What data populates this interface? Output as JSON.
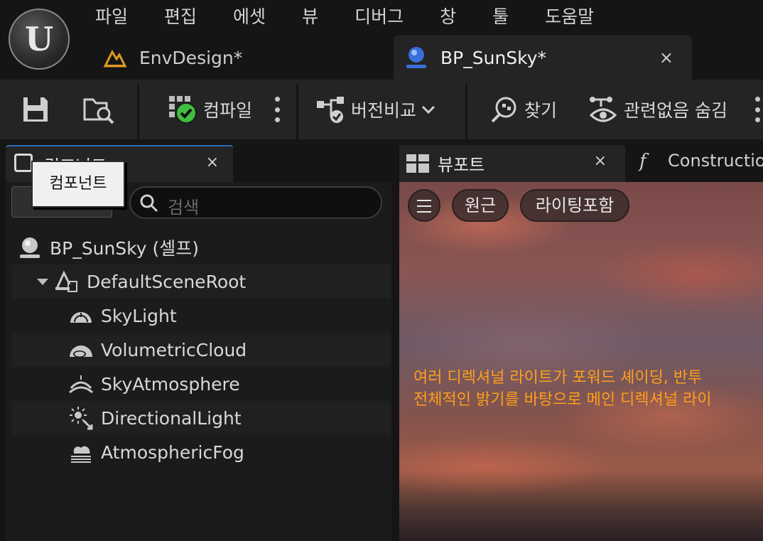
{
  "menu": [
    "파일",
    "편집",
    "에셋",
    "뷰",
    "디버그",
    "창",
    "툴",
    "도움말"
  ],
  "tabs": [
    {
      "label": "EnvDesign*"
    },
    {
      "label": "BP_SunSky*",
      "close": "×"
    }
  ],
  "toolbar": {
    "compile_label": "컴파일",
    "diff_label": "버전비교",
    "find_label": "찾기",
    "hide_label": "관련없음 숨김"
  },
  "components_panel": {
    "tab_label": "컴포넌트",
    "close": "×",
    "search_placeholder": "검색",
    "tooltip": "컴포넌트",
    "tree": [
      {
        "label": "BP_SunSky (셀프)",
        "icon": "sunsky-icon"
      },
      {
        "label": "DefaultSceneRoot",
        "icon": "scene-root-icon"
      },
      {
        "label": "SkyLight",
        "icon": "skylight-icon"
      },
      {
        "label": "VolumetricCloud",
        "icon": "cloud-icon"
      },
      {
        "label": "SkyAtmosphere",
        "icon": "atmosphere-icon"
      },
      {
        "label": "DirectionalLight",
        "icon": "directional-light-icon"
      },
      {
        "label": "AtmosphericFog",
        "icon": "fog-icon"
      }
    ]
  },
  "viewport_panel": {
    "tab_label": "뷰포트",
    "close": "×",
    "construction_tab": "Construction Script",
    "btn_perspective": "원근",
    "btn_lit": "라이팅포함",
    "warning_line1": "여러 디렉셔널 라이트가 포워드 셰이딩, 반투",
    "warning_line2": "전체적인 밝기를 바탕으로 메인 디렉셔널 라이"
  },
  "colors": {
    "accent": "#2a6fb8",
    "warning": "#ff9f1a",
    "check": "#3fbf3f"
  }
}
